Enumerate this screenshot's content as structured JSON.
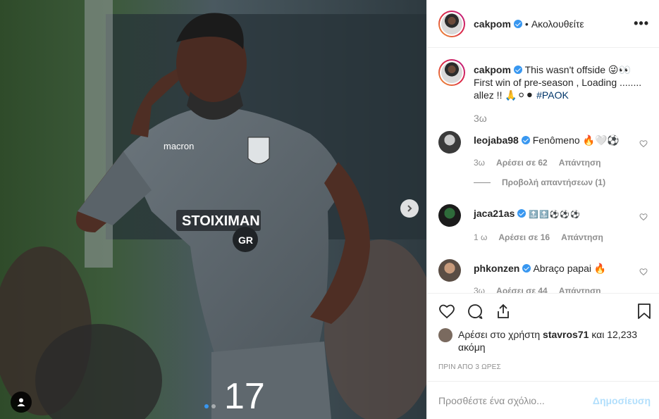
{
  "header": {
    "username": "cakpom",
    "separator": "•",
    "follow_label": "Ακολουθείτε",
    "more_label": "•••"
  },
  "caption": {
    "username": "cakpom",
    "text": "This wasn't offside 😜👀 First win of pre-season , Loading ........ allez !! 🙏⚪⚫ ",
    "hashtag": "#PAOK",
    "time": "3ω"
  },
  "comments": [
    {
      "username": "leojaba98",
      "verified": true,
      "text": "Fenômeno 🔥🤍⚽",
      "time": "3ω",
      "likes": "Αρέσει σε 62",
      "reply": "Απάντηση",
      "view_replies": "Προβολή απαντήσεων (1)"
    },
    {
      "username": "jaca21as",
      "verified": true,
      "text": "🔝🔝⚽⚽⚽",
      "time": "1 ω",
      "likes": "Αρέσει σε 16",
      "reply": "Απάντηση"
    },
    {
      "username": "phkonzen",
      "verified": true,
      "text": "Abraço papai 🔥",
      "time": "3ω",
      "likes": "Αρέσει σε 44",
      "reply": "Απάντηση"
    }
  ],
  "likes_summary": {
    "prefix": "Αρέσει στο χρήστη",
    "user": "stavros71",
    "suffix": "και 12,233 ακόμη"
  },
  "posted": "ΠΡΙΝ ΑΠΟ 3 ΩΡΕΣ",
  "add_comment": {
    "placeholder": "Προσθέστε ένα σχόλιο...",
    "post_label": "Δημοσίευση"
  },
  "photo": {
    "jersey_sponsor": "STOIXIMAN",
    "jersey_sponsor_sub": "GR",
    "jersey_brand": "macron",
    "badge": "ΠΑΟΚ",
    "shorts_number": "17",
    "slide_count": 2
  },
  "colors": {
    "accent": "#3897f0",
    "hashtag": "#003569",
    "muted": "#8e8e8e"
  }
}
